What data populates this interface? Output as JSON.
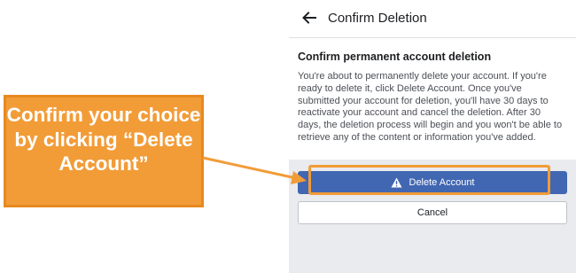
{
  "header": {
    "title": "Confirm Deletion"
  },
  "card": {
    "heading": "Confirm permanent account deletion",
    "body": "You're about to permanently delete your account. If you're ready to delete it, click Delete Account. Once you've submitted your account for deletion, you'll have 30 days to reactivate your account and cancel the deletion. After 30 days, the deletion process will begin and you won't be able to retrieve any of the content or information you've added."
  },
  "actions": {
    "delete_label": "Delete Account",
    "cancel_label": "Cancel"
  },
  "annotation": {
    "callout_text": "Confirm your choice by clicking “Delete Account”"
  },
  "icons": {
    "back": "back-arrow-icon",
    "warning": "warning-icon"
  },
  "colors": {
    "primary_button": "#4267b2",
    "annotation": "#f29c38",
    "panel_background": "#e9ebee"
  }
}
